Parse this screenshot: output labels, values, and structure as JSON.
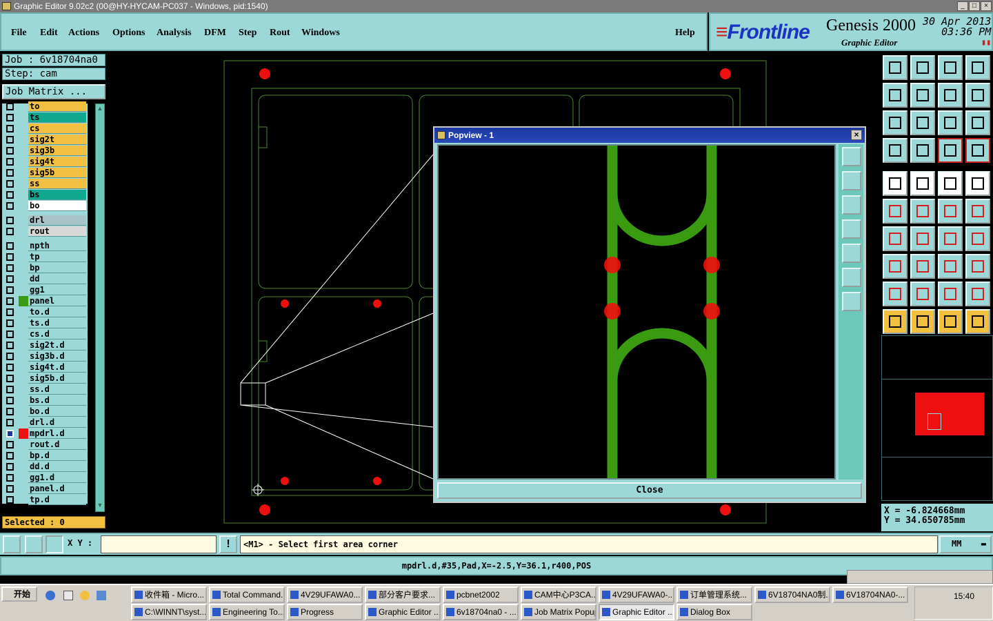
{
  "window": {
    "title": "Graphic Editor 9.02c2 (00@HY-HYCAM-PC037 - Windows, pid:1540)"
  },
  "menu": {
    "items": [
      "File",
      "Edit",
      "Actions",
      "Options",
      "Analysis",
      "DFM",
      "Step",
      "Rout",
      "Windows"
    ],
    "help": "Help"
  },
  "brand": {
    "logo": "Frontline",
    "product": "Genesis 2000",
    "subtitle": "Graphic Editor",
    "date": "30 Apr 2013",
    "time": "03:36 PM"
  },
  "job": {
    "job_label": "Job : 6v18704na0",
    "step_label": "Step: cam",
    "matrix_button": "Job Matrix ..."
  },
  "layers": [
    {
      "name": "to",
      "color": "#f2c040",
      "cbfill": "#9cd8d8"
    },
    {
      "name": "ts",
      "color": "#10a890"
    },
    {
      "name": "cs",
      "color": "#f2c040"
    },
    {
      "name": "sig2t",
      "color": "#f2c040"
    },
    {
      "name": "sig3b",
      "color": "#f2c040"
    },
    {
      "name": "sig4t",
      "color": "#f2c040"
    },
    {
      "name": "sig5b",
      "color": "#f2c040"
    },
    {
      "name": "ss",
      "color": "#f2c040"
    },
    {
      "name": "bs",
      "color": "#10a890"
    },
    {
      "name": "bo",
      "color": "#ffffff"
    },
    {
      "name": "drl",
      "color": "#a8c4c8",
      "gap": true
    },
    {
      "name": "rout",
      "color": "#d8d8d8"
    },
    {
      "name": "npth",
      "color": "#9cd8d8",
      "gap": true
    },
    {
      "name": "tp",
      "color": "#9cd8d8"
    },
    {
      "name": "bp",
      "color": "#9cd8d8"
    },
    {
      "name": "dd",
      "color": "#9cd8d8"
    },
    {
      "name": "gg1",
      "color": "#9cd8d8"
    },
    {
      "name": "panel",
      "color": "#9cd8d8",
      "swatch": "#3a9a10"
    },
    {
      "name": "to.d",
      "color": "#9cd8d8"
    },
    {
      "name": "ts.d",
      "color": "#9cd8d8"
    },
    {
      "name": "cs.d",
      "color": "#9cd8d8"
    },
    {
      "name": "sig2t.d",
      "color": "#9cd8d8"
    },
    {
      "name": "sig3b.d",
      "color": "#9cd8d8"
    },
    {
      "name": "sig4t.d",
      "color": "#9cd8d8"
    },
    {
      "name": "sig5b.d",
      "color": "#9cd8d8"
    },
    {
      "name": "ss.d",
      "color": "#9cd8d8"
    },
    {
      "name": "bs.d",
      "color": "#9cd8d8"
    },
    {
      "name": "bo.d",
      "color": "#9cd8d8"
    },
    {
      "name": "drl.d",
      "color": "#9cd8d8"
    },
    {
      "name": "mpdrl.d",
      "color": "#9cd8d8",
      "swatch": "#ee1010",
      "active": true
    },
    {
      "name": "rout.d",
      "color": "#9cd8d8"
    },
    {
      "name": "bp.d",
      "color": "#9cd8d8"
    },
    {
      "name": "dd.d",
      "color": "#9cd8d8"
    },
    {
      "name": "gg1.d",
      "color": "#9cd8d8"
    },
    {
      "name": "panel.d",
      "color": "#9cd8d8"
    },
    {
      "name": "tp.d",
      "color": "#9cd8d8"
    }
  ],
  "selected": "Selected : 0",
  "popup": {
    "title": "Popview - 1",
    "close_label": "Close"
  },
  "coords": {
    "x": "X = -6.824668mm",
    "y": "Y = 34.650785mm"
  },
  "command": {
    "xy_label": "X Y :",
    "xy_value": "",
    "prompt": "<M1> - Select first area corner",
    "units": "MM"
  },
  "status_line": "mpdrl.d,#35,Pad,X=-2.5,Y=36.1,r400,POS",
  "taskbar": {
    "start": "开始",
    "row1": [
      "收件箱 - Micro...",
      "Total Command...",
      "4V29UFAWA0...",
      "部分客户要求...",
      "pcbnet2002",
      "CAM中心P3CA...",
      "4V29UFAWA0-...",
      "订单管理系统...",
      "6V18704NA0制...",
      "6V18704NA0-..."
    ],
    "row2": [
      "C:\\WINNT\\syst...",
      "Engineering To...",
      "Progress",
      "Graphic Editor ...",
      "6v18704na0 - ...",
      "Job Matrix Popup",
      "Graphic Editor ...",
      "Dialog Box"
    ],
    "clock": "15:40"
  },
  "colors": {
    "panel": "#9cd8d8",
    "accent_teal": "#6cc8b8",
    "trace_green": "#3a9a10",
    "pad_red": "#ee1010",
    "outline_green": "#4a8a28"
  }
}
